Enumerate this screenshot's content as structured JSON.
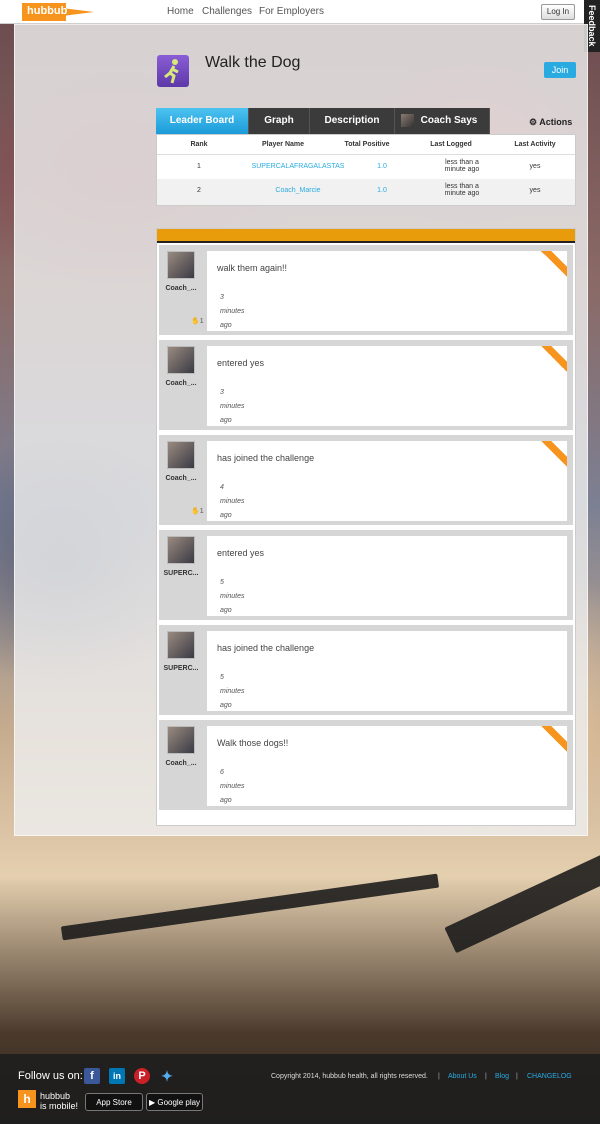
{
  "topbar": {
    "logo": "hubbub",
    "nav": [
      "Home",
      "Challenges",
      "For Employers"
    ],
    "login": "Log In",
    "feedback": "Feedback"
  },
  "challenge": {
    "title": "Walk the Dog",
    "join": "Join"
  },
  "tabs": [
    "Leader Board",
    "Graph",
    "Description",
    "Coach Says"
  ],
  "actions": "Actions",
  "leaderboard": {
    "columns": [
      "Rank",
      "Player Name",
      "Total Positive",
      "Last Logged",
      "Last Activity"
    ],
    "rows": [
      {
        "rank": "1",
        "name": "SUPERCALAFRAGALASTAS",
        "total": "1.0",
        "logged": "less than a minute ago",
        "activity": "yes"
      },
      {
        "rank": "2",
        "name": "Coach_Marcie",
        "total": "1.0",
        "logged": "less than a minute ago",
        "activity": "yes"
      }
    ]
  },
  "feed": [
    {
      "name": "Coach_...",
      "message": "walk them again!!",
      "num": "3",
      "unit": "minutes",
      "ago": "ago",
      "likes": "1"
    },
    {
      "name": "Coach_...",
      "message": "entered yes",
      "num": "3",
      "unit": "minutes",
      "ago": "ago",
      "likes": ""
    },
    {
      "name": "Coach_...",
      "message": "has joined the challenge",
      "num": "4",
      "unit": "minutes",
      "ago": "ago",
      "likes": "1"
    },
    {
      "name": "SUPERC...",
      "message": "entered yes",
      "num": "5",
      "unit": "minutes",
      "ago": "ago",
      "likes": ""
    },
    {
      "name": "SUPERC...",
      "message": "has joined the challenge",
      "num": "5",
      "unit": "minutes",
      "ago": "ago",
      "likes": ""
    },
    {
      "name": "Coach_...",
      "message": "Walk those dogs!!",
      "num": "6",
      "unit": "minutes",
      "ago": "ago",
      "likes": ""
    }
  ],
  "footer": {
    "follow": "Follow us on:",
    "copyright": "Copyright 2014, hubbub health, all rights reserved.",
    "links": [
      "About Us",
      "Blog",
      "CHANGELOG"
    ],
    "mobile_line1": "hubbub",
    "mobile_line2": "is mobile!",
    "appstore": "App Store",
    "googleplay": "Google play"
  }
}
